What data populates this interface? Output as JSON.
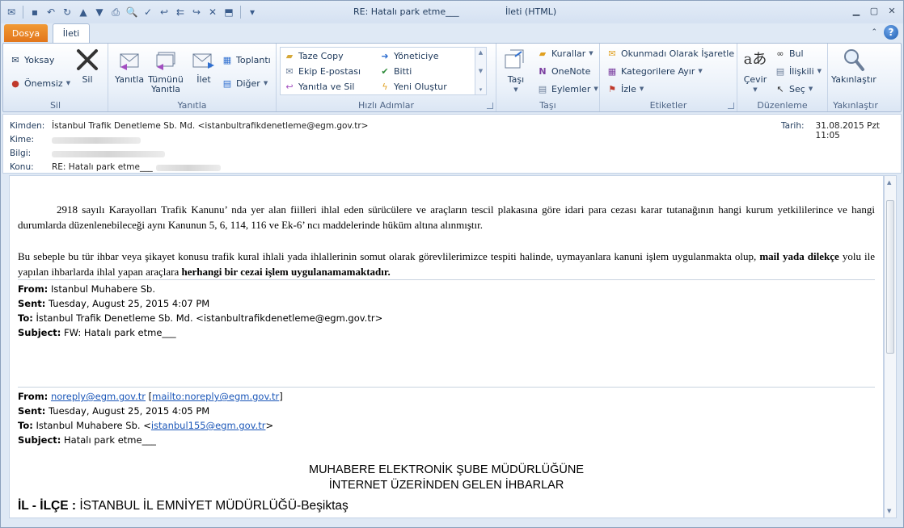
{
  "window": {
    "title": "RE: Hatalı park etme___",
    "mode": "İleti (HTML)"
  },
  "tabs": {
    "file": "Dosya",
    "message": "İleti"
  },
  "ribbon": {
    "groups": {
      "delete": "Sil",
      "respond": "Yanıtla",
      "quick_steps": "Hızlı Adımlar",
      "move": "Taşı",
      "tags": "Etiketler",
      "editing": "Düzenleme",
      "zoom": "Yakınlaştır"
    },
    "ignore": "Yoksay",
    "junk": "Önemsiz",
    "delete_btn": "Sil",
    "reply": "Yanıtla",
    "reply_all": "Tümünü Yanıtla",
    "forward": "İlet",
    "meeting": "Toplantı",
    "more": "Diğer",
    "quick": [
      "Taze Copy",
      "Yöneticiye",
      "Ekip E-postası",
      "Bitti",
      "Yanıtla ve Sil",
      "Yeni Oluştur"
    ],
    "move_btn": "Taşı",
    "rules": "Kurallar",
    "onenote": "OneNote",
    "actions": "Eylemler",
    "mark_unread": "Okunmadı Olarak İşaretle",
    "categorize": "Kategorilere Ayır",
    "follow_up": "İzle",
    "translate": "Çevir",
    "find": "Bul",
    "related": "İlişkili",
    "select": "Seç",
    "zoom_btn": "Yakınlaştır"
  },
  "header": {
    "from_label": "Kimden:",
    "from_value": "İstanbul Trafik Denetleme Sb. Md. <istanbultrafikdenetleme@egm.gov.tr>",
    "to_label": "Kime:",
    "cc_label": "Bilgi:",
    "subject_label": "Konu:",
    "subject_value": "RE: Hatalı park etme___",
    "date_label": "Tarih:",
    "date_value": "31.08.2015 Pzt 11:05"
  },
  "body": {
    "p1": "2918 sayılı Karayolları Trafik Kanunu’ nda yer alan fiilleri ihlal eden sürücülere ve araçların tescil plakasına göre idari para cezası karar tutanağının hangi kurum yetkililerince ve hangi durumlarda düzenlenebileceği aynı Kanunun 5, 6, 114, 116 ve Ek-6’ ncı maddelerinde hüküm altına alınmıştır.",
    "p2_a": "Bu sebeple bu tür ihbar veya şikayet konusu trafik kural ihlali yada ihlallerinin somut olarak görevlilerimizce tespiti halinde, uymayanlara kanuni işlem uygulanmakta olup, ",
    "p2_b": "mail yada dilekçe",
    "p2_c": " yolu ile yapılan ihbarlarda ihlal yapan araçlara ",
    "p2_d": "herhangi bir cezai işlem uygulanamamaktadır.",
    "fw1": {
      "from_label": "From:",
      "from": "Istanbul Muhabere Sb.",
      "sent_label": "Sent:",
      "sent": "Tuesday, August 25, 2015 4:07 PM",
      "to_label": "To:",
      "to": "İstanbul Trafik Denetleme Sb. Md. <istanbultrafikdenetleme@egm.gov.tr>",
      "subject_label": "Subject:",
      "subject": "FW: Hatalı park etme___"
    },
    "fw2": {
      "from_label": "From:",
      "from_link": "noreply@egm.gov.tr",
      "from_mailto": "mailto:noreply@egm.gov.tr",
      "sent_label": "Sent:",
      "sent": "Tuesday, August 25, 2015 4:05 PM",
      "to_label": "To:",
      "to": "Istanbul Muhabere Sb. <",
      "to_link": "istanbul155@egm.gov.tr",
      "subject_label": "Subject:",
      "subject": "Hatalı park etme___"
    },
    "title1": "MUHABERE ELEKTRONİK ŞUBE MÜDÜRLÜĞÜNE",
    "title2": "İNTERNET ÜZERİNDEN GELEN İHBARLAR",
    "il_label": "İL - İLÇE :",
    "il_value": " İSTANBUL İL EMNİYET MÜDÜRLÜĞÜ-Beşiktaş"
  }
}
